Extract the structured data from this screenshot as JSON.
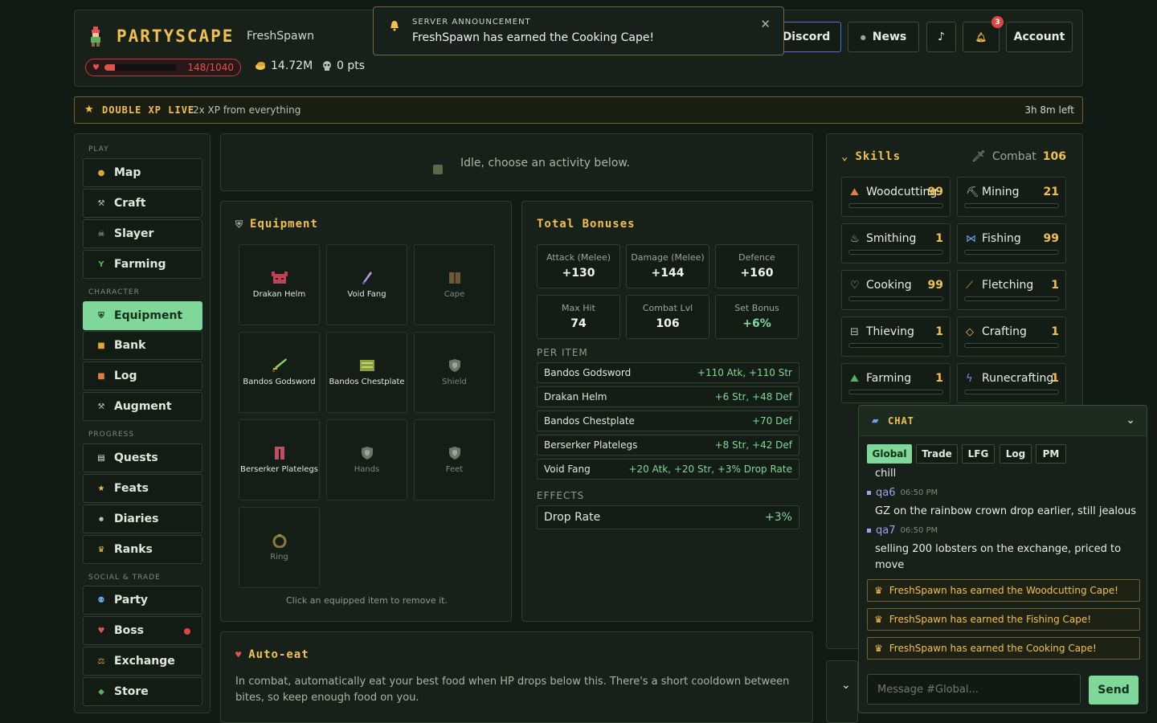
{
  "header": {
    "logo": "PARTYSCAPE",
    "username": "FreshSpawn",
    "hp_text": "148/1040",
    "hp_fraction": 0.142,
    "gold": "14.72M",
    "points": "0 pts",
    "buttons": {
      "discord": "Discord",
      "news": "News",
      "music": "♪",
      "notif_count": "3",
      "account": "Account"
    }
  },
  "toast": {
    "label": "SERVER ANNOUNCEMENT",
    "message": "FreshSpawn has earned the Cooking Cape!"
  },
  "xp_banner": {
    "title": "DOUBLE XP LIVE",
    "desc": "2x XP from everything",
    "time_left": "3h 8m left"
  },
  "sidebar": {
    "sections": [
      "PLAY",
      "CHARACTER",
      "PROGRESS",
      "SOCIAL & TRADE"
    ],
    "play": [
      "Map",
      "Craft",
      "Slayer",
      "Farming"
    ],
    "character": [
      "Equipment",
      "Bank",
      "Log",
      "Augment"
    ],
    "progress": [
      "Quests",
      "Feats",
      "Diaries",
      "Ranks"
    ],
    "social": [
      "Party",
      "Boss",
      "Exchange",
      "Store"
    ]
  },
  "idle": {
    "text": "Idle, choose an activity below."
  },
  "equipment": {
    "title": "Equipment",
    "slots": [
      "Drakan Helm",
      "Void Fang",
      "Cape",
      "Bandos Godsword",
      "Bandos Chestplate",
      "Shield",
      "Berserker Platelegs",
      "Hands",
      "Feet",
      "Ring"
    ],
    "hint": "Click an equipped item to remove it."
  },
  "bonuses": {
    "title": "Total Bonuses",
    "stats": [
      {
        "k": "Attack (Melee)",
        "v": "+130"
      },
      {
        "k": "Damage (Melee)",
        "v": "+144"
      },
      {
        "k": "Defence",
        "v": "+160"
      },
      {
        "k": "Max Hit",
        "v": "74"
      },
      {
        "k": "Combat Lvl",
        "v": "106"
      },
      {
        "k": "Set Bonus",
        "v": "+6%"
      }
    ],
    "per_item_label": "PER ITEM",
    "per_item": [
      {
        "n": "Bandos Godsword",
        "v": "+110 Atk, +110 Str"
      },
      {
        "n": "Drakan Helm",
        "v": "+6 Str, +48 Def"
      },
      {
        "n": "Bandos Chestplate",
        "v": "+70 Def"
      },
      {
        "n": "Berserker Platelegs",
        "v": "+8 Str, +42 Def"
      },
      {
        "n": "Void Fang",
        "v": "+20 Atk, +20 Str, +3% Drop Rate"
      }
    ],
    "effects_label": "EFFECTS",
    "effects": [
      {
        "n": "Drop Rate",
        "v": "+3%"
      }
    ]
  },
  "autoeat": {
    "title": "Auto-eat",
    "desc": "In combat, automatically eat your best food when HP drops below this. There's a short cooldown between bites, so keep enough food on you."
  },
  "skills": {
    "title": "Skills",
    "combat_label": "Combat",
    "combat_level": "106",
    "list": [
      {
        "n": "Woodcutting",
        "l": "99"
      },
      {
        "n": "Mining",
        "l": "21"
      },
      {
        "n": "Smithing",
        "l": "1"
      },
      {
        "n": "Fishing",
        "l": "99"
      },
      {
        "n": "Cooking",
        "l": "99"
      },
      {
        "n": "Fletching",
        "l": "1"
      },
      {
        "n": "Thieving",
        "l": "1"
      },
      {
        "n": "Crafting",
        "l": "1"
      },
      {
        "n": "Farming",
        "l": "1"
      },
      {
        "n": "Runecrafting",
        "l": "1"
      }
    ]
  },
  "chat": {
    "title": "CHAT",
    "tabs": [
      "Global",
      "Trade",
      "LFG",
      "Log",
      "PM"
    ],
    "partial": "chill",
    "messages": [
      {
        "user": "qa6",
        "time": "06:50 PM",
        "text": "GZ on the rainbow crown drop earlier, still jealous"
      },
      {
        "user": "qa7",
        "time": "06:50 PM",
        "text": "selling 200 lobsters on the exchange, priced to move"
      }
    ],
    "system": [
      "FreshSpawn has earned the Woodcutting Cape!",
      "FreshSpawn has earned the Fishing Cape!",
      "FreshSpawn has earned the Cooking Cape!"
    ],
    "placeholder": "Message #Global...",
    "send": "Send"
  }
}
